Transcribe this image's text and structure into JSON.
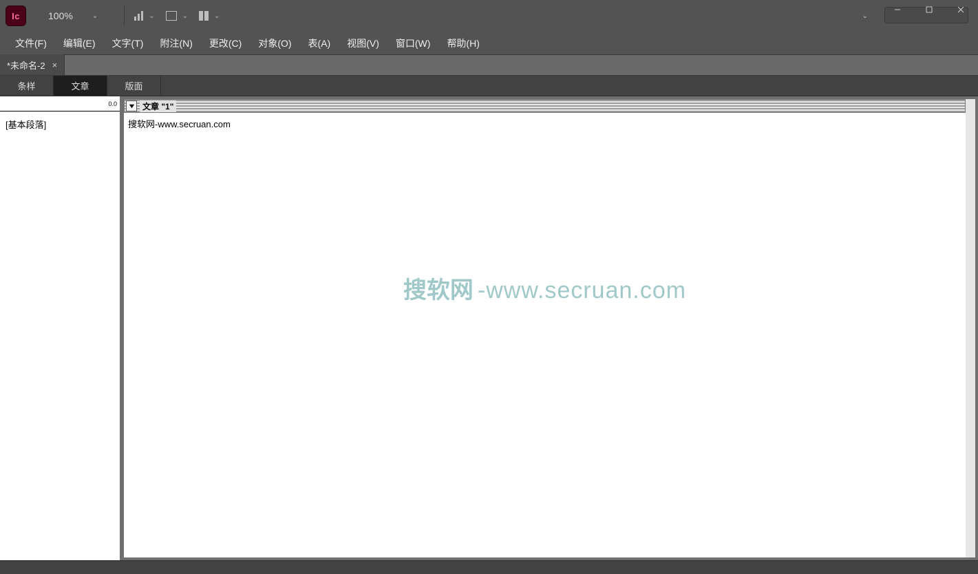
{
  "app": {
    "logo_text": "Ic"
  },
  "toolbar": {
    "zoom": "100%"
  },
  "window": {
    "min": "minimize",
    "max": "maximize",
    "close": "close"
  },
  "menu": [
    "文件(F)",
    "编辑(E)",
    "文字(T)",
    "附注(N)",
    "更改(C)",
    "对象(O)",
    "表(A)",
    "视图(V)",
    "窗口(W)",
    "帮助(H)"
  ],
  "doc_tab": {
    "title": "*未命名-2"
  },
  "subtabs": [
    "条样",
    "文章",
    "版面"
  ],
  "active_subtab": 1,
  "left_panel": {
    "ruler": "0.0",
    "style": "[基本段落]"
  },
  "story": {
    "header": "文章 \"1\"",
    "text": "搜软网-www.secruan.com"
  },
  "watermark": {
    "a": "搜软网",
    "b": "-www.secruan.com"
  },
  "search": {
    "placeholder": ""
  }
}
